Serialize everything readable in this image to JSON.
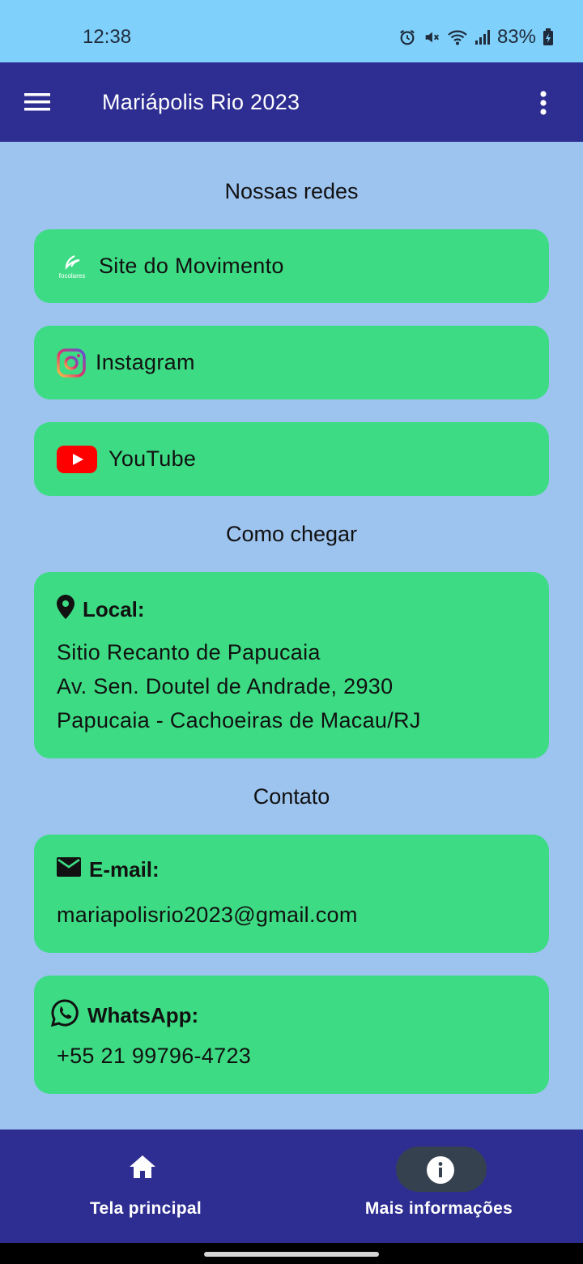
{
  "status_bar": {
    "time": "12:38",
    "battery": "83%"
  },
  "app_bar": {
    "title": "Mariápolis Rio 2023"
  },
  "sections": {
    "redes_title": "Nossas redes",
    "chegar_title": "Como chegar",
    "contato_title": "Contato"
  },
  "links": {
    "site": "Site do Movimento",
    "instagram": "Instagram",
    "youtube": "YouTube",
    "site_logo_text": "focolares"
  },
  "location": {
    "label": "Local:",
    "line1": "Sitio Recanto de Papucaia",
    "line2": "Av. Sen. Doutel de Andrade, 2930",
    "line3": "Papucaia - Cachoeiras de Macau/RJ"
  },
  "email": {
    "label": "E-mail:",
    "value": "mariapolisrio2023@gmail.com"
  },
  "whatsapp": {
    "label": "WhatsApp:",
    "value": "+55 21 99796-4723"
  },
  "bottom_nav": {
    "home": "Tela principal",
    "info": "Mais informações"
  },
  "colors": {
    "status_bar": "#7fd0fb",
    "app_bar": "#2e2e92",
    "background": "#9dc3ef",
    "card": "#3ddc84"
  },
  "icons": [
    "menu-icon",
    "more-vert-icon",
    "focolares-logo",
    "instagram-icon",
    "youtube-icon",
    "location-pin-icon",
    "mail-icon",
    "whatsapp-icon",
    "home-icon",
    "info-icon"
  ]
}
